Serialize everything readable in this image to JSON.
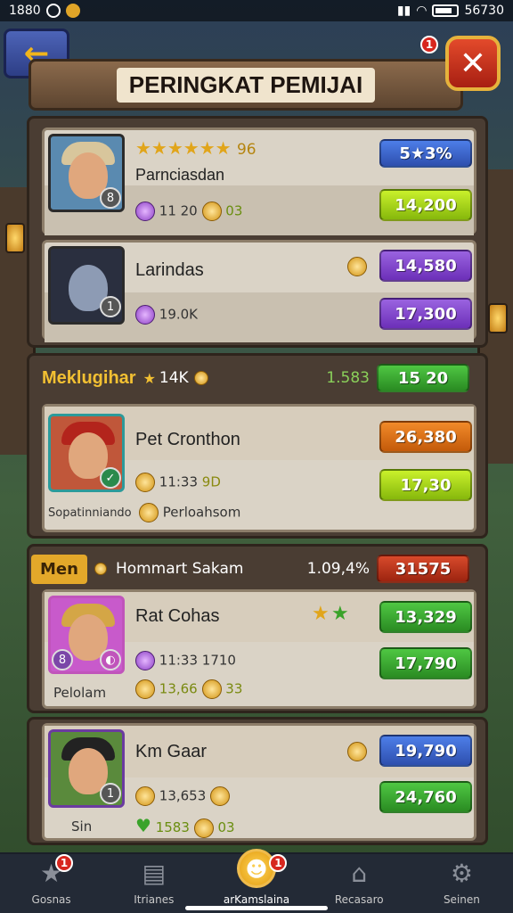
{
  "status_bar": {
    "time": "1880",
    "battery": "56730"
  },
  "header": {
    "title": "PERINGKAT PEMIJAI",
    "close_badge": "1"
  },
  "section1": {
    "rows": [
      {
        "stars": "★★★★★★",
        "star_extra": "96",
        "name": "Parnciasdan",
        "stat": "11 20",
        "stat_suffix": "03",
        "rank_badge": "5★3%",
        "score": "14,200",
        "score_color": "lime",
        "score_label": ""
      },
      {
        "name": "Larindas",
        "stat": "19.0K",
        "score": "14,580",
        "score2": "17,300"
      }
    ]
  },
  "section2": {
    "header_title": "Meklugihar",
    "header_stat": "14K",
    "header_right": "1.583",
    "header_score": "15 20",
    "card": {
      "name": "Pet Cronthon",
      "stat": "11:33",
      "stat_suffix": "9D",
      "sub_left": "Sopatinniando",
      "sub_right": "Perloahsom",
      "score1": "26,380",
      "score2": "17,30"
    }
  },
  "section3": {
    "tag": "Men",
    "header_title": "Hommart Sakam",
    "header_pct": "1.09,4%",
    "header_score": "31575",
    "card": {
      "name": "Rat Cohas",
      "stat": "11:33 1710",
      "stat2": "13,66",
      "stat2_suffix": "33",
      "sub_left": "Pelolam",
      "score1": "13,329",
      "score2": "17,790"
    }
  },
  "section4": {
    "card": {
      "name": "Km Gaar",
      "stat": "13,653",
      "stat2": "1583",
      "stat2_suffix": "03",
      "sub_left": "Sin",
      "score1": "19,790",
      "score2": "24,760"
    }
  },
  "nav": [
    {
      "label": "Gosnas",
      "icon": "★",
      "badge": "1"
    },
    {
      "label": "Itrianes",
      "icon": "▤",
      "badge": ""
    },
    {
      "label": "arKamslaina",
      "icon": "☻",
      "badge": "1"
    },
    {
      "label": "Recasaro",
      "icon": "⌂",
      "badge": ""
    },
    {
      "label": "Seinen",
      "icon": "⚙",
      "badge": ""
    }
  ]
}
